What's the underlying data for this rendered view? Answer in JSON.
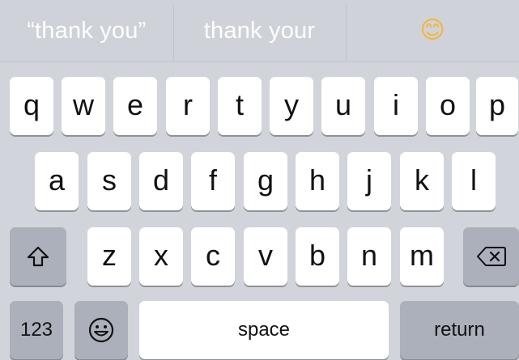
{
  "suggestions": {
    "quoted": "“thank you”",
    "option": "thank your",
    "emoji": "😊"
  },
  "rows": {
    "row1": [
      "q",
      "w",
      "e",
      "r",
      "t",
      "y",
      "u",
      "i",
      "o",
      "p"
    ],
    "row2": [
      "a",
      "s",
      "d",
      "f",
      "g",
      "h",
      "j",
      "k",
      "l"
    ],
    "row3": [
      "z",
      "x",
      "c",
      "v",
      "b",
      "n",
      "m"
    ]
  },
  "bottom": {
    "numbers_label": "123",
    "space_label": "space",
    "return_label": "return"
  },
  "icons": {
    "shift": "shift-icon",
    "delete": "backspace-icon",
    "emoji_keyboard": "emoji-keyboard-icon"
  },
  "colors": {
    "keyboard_background": "#d1d4da",
    "letter_key": "#ffffff",
    "function_key": "#abb0bb"
  }
}
